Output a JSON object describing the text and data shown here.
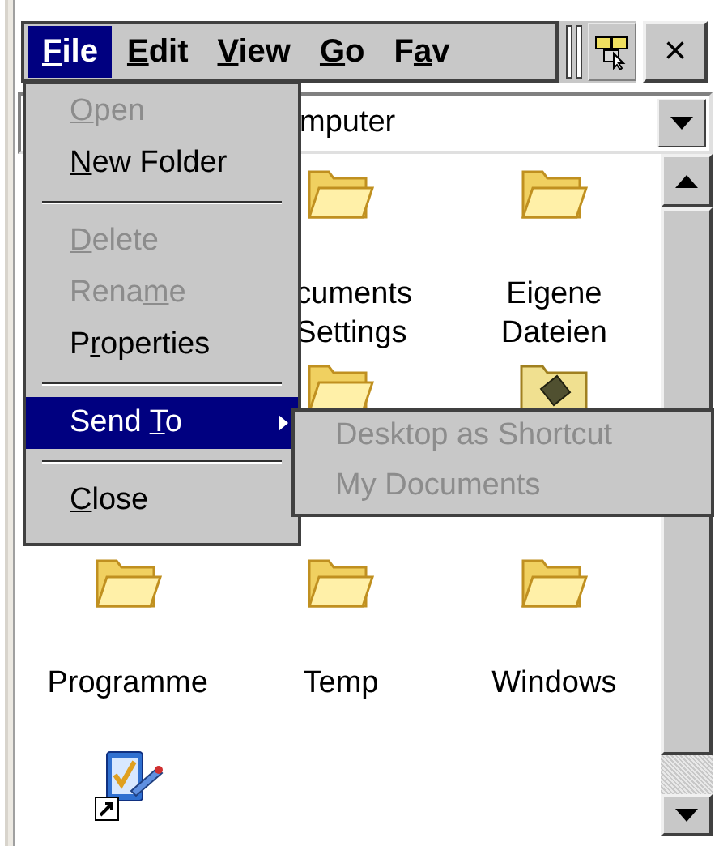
{
  "menu_bar": {
    "items": [
      {
        "label": {
          "mnemonic": "F",
          "after": "ile"
        },
        "selected": true
      },
      {
        "label": {
          "mnemonic": "E",
          "after": "dit"
        },
        "selected": false
      },
      {
        "label": {
          "mnemonic": "V",
          "after": "iew"
        },
        "selected": false
      },
      {
        "label": {
          "mnemonic": "G",
          "after": "o"
        },
        "selected": false
      },
      {
        "label": {
          "before": "F",
          "mnemonic": "a",
          "after": "v"
        },
        "selected": false
      }
    ]
  },
  "close_button": "×",
  "address": {
    "value": "mputer"
  },
  "file_menu": {
    "items": [
      {
        "kind": "item",
        "label": {
          "mnemonic": "O",
          "after": "pen"
        },
        "disabled": true,
        "selected": false
      },
      {
        "kind": "item",
        "label": {
          "mnemonic": "N",
          "after": "ew Folder"
        },
        "disabled": false,
        "selected": false
      },
      {
        "kind": "separator"
      },
      {
        "kind": "item",
        "label": {
          "mnemonic": "D",
          "after": "elete"
        },
        "disabled": true,
        "selected": false
      },
      {
        "kind": "item",
        "label": {
          "before": "Rena",
          "mnemonic": "m",
          "after": "e"
        },
        "disabled": true,
        "selected": false
      },
      {
        "kind": "item",
        "label": {
          "before": "P",
          "mnemonic": "r",
          "after": "operties"
        },
        "disabled": false,
        "selected": false
      },
      {
        "kind": "separator"
      },
      {
        "kind": "submenu",
        "label": {
          "before": "Send ",
          "mnemonic": "T",
          "after": "o"
        },
        "disabled": false,
        "selected": true
      },
      {
        "kind": "separator"
      },
      {
        "kind": "item",
        "label": {
          "mnemonic": "C",
          "after": "lose"
        },
        "disabled": false,
        "selected": false
      }
    ]
  },
  "send_to_menu": {
    "items": [
      {
        "label": "Desktop as Shortcut",
        "disabled": true
      },
      {
        "label": "My Documents",
        "disabled": true
      }
    ]
  },
  "icons": [
    {
      "cells": [
        null,
        {
          "kind": "folder",
          "label_lines": [
            "cuments",
            "Settings"
          ],
          "label_clipped": true
        },
        {
          "kind": "folder",
          "label_lines": [
            "Eigene",
            "Dateien"
          ],
          "label_clipped": false
        }
      ]
    },
    {
      "cells": [
        null,
        {
          "kind": "folder"
        },
        {
          "kind": "special_folder"
        }
      ]
    },
    {
      "cells": [
        {
          "kind": "folder",
          "label_lines": [
            "Programme"
          ],
          "label_clipped": false
        },
        {
          "kind": "folder",
          "label_lines": [
            "Temp"
          ],
          "label_clipped": false
        },
        {
          "kind": "folder",
          "label_lines": [
            "Windows"
          ],
          "label_clipped": false
        }
      ]
    },
    {
      "cells": [
        {
          "kind": "shortcut"
        },
        null,
        null
      ]
    }
  ]
}
